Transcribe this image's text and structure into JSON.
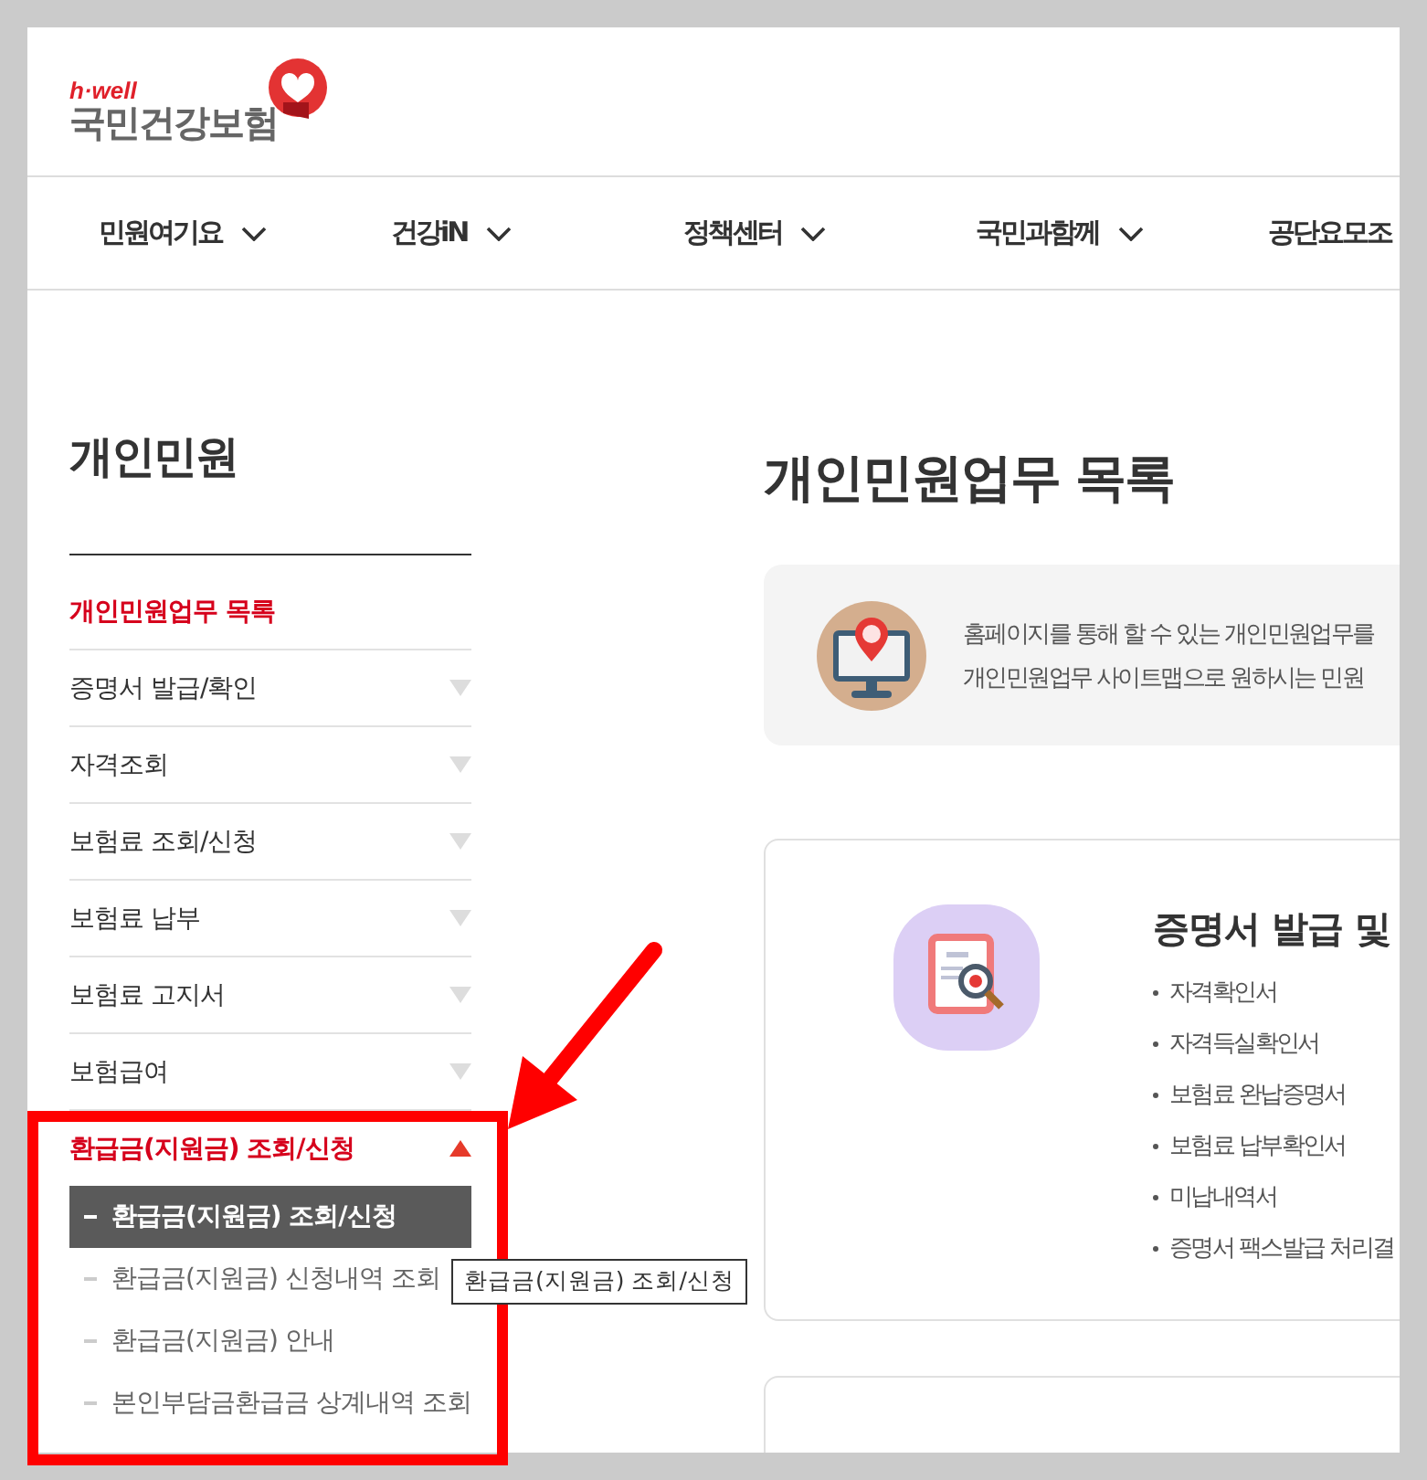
{
  "logo": {
    "tagline": "h·well",
    "name": "국민건강보험"
  },
  "nav": [
    {
      "label": "민원여기요"
    },
    {
      "label": "건강iN"
    },
    {
      "label": "정책센터"
    },
    {
      "label": "국민과함께"
    },
    {
      "label": "공단요모조"
    }
  ],
  "sidebar": {
    "title": "개인민원",
    "items": [
      {
        "label": "개인민원업무 목록",
        "kind": "link",
        "selected": true
      },
      {
        "label": "증명서 발급/확인",
        "kind": "group",
        "selected": false,
        "expanded": false
      },
      {
        "label": "자격조회",
        "kind": "group",
        "selected": false,
        "expanded": false
      },
      {
        "label": "보험료 조회/신청",
        "kind": "group",
        "selected": false,
        "expanded": false
      },
      {
        "label": "보험료 납부",
        "kind": "group",
        "selected": false,
        "expanded": false
      },
      {
        "label": "보험료 고지서",
        "kind": "group",
        "selected": false,
        "expanded": false
      },
      {
        "label": "보험급여",
        "kind": "group",
        "selected": false,
        "expanded": false
      },
      {
        "label": "환급금(지원금) 조회/신청",
        "kind": "group",
        "selected": true,
        "expanded": true,
        "children": [
          {
            "label": "환급금(지원금) 조회/신청",
            "selected": true
          },
          {
            "label": "환급금(지원금) 신청내역 조회",
            "selected": false
          },
          {
            "label": "환급금(지원금) 안내",
            "selected": false
          },
          {
            "label": "본인부담금환급금 상계내역 조회",
            "selected": false
          }
        ]
      }
    ]
  },
  "tooltip": {
    "text": "환급금(지원금) 조회/신청"
  },
  "main": {
    "title": "개인민원업무 목록",
    "intro": {
      "lines": [
        "홈페이지를 통해 할 수 있는 개인민원업무를",
        "개인민원업무 사이트맵으로 원하시는 민원"
      ]
    },
    "cards": [
      {
        "title": "증명서 발급 및",
        "items": [
          "자격확인서",
          "자격득실확인서",
          "보험료 완납증명서",
          "보험료 납부확인서",
          "미납내역서",
          "증명서 팩스발급 처리결"
        ]
      }
    ]
  }
}
